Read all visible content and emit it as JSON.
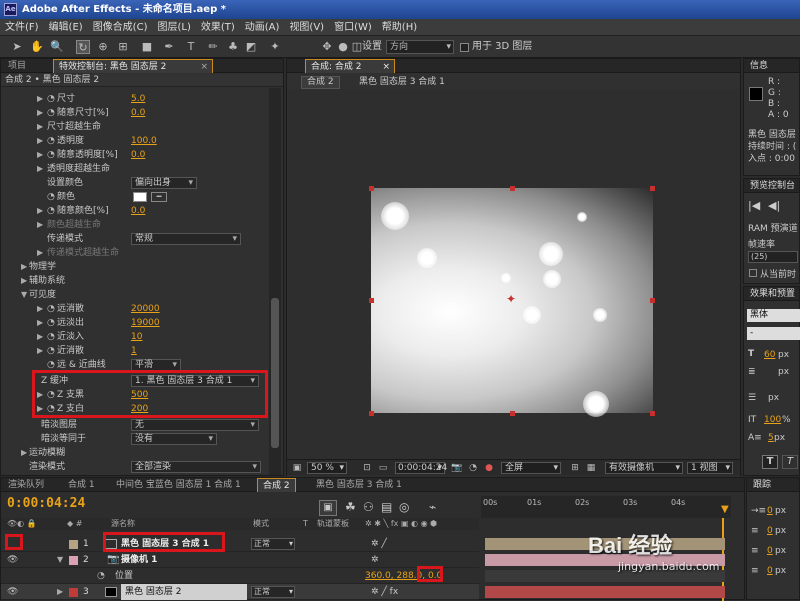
{
  "app": {
    "title": "Adobe After Effects - 未命名项目.aep *",
    "icon_text": "Ae"
  },
  "menu": [
    "文件(F)",
    "编辑(E)",
    "图像合成(C)",
    "图层(L)",
    "效果(T)",
    "动画(A)",
    "视图(V)",
    "窗口(W)",
    "帮助(H)"
  ],
  "toolbar": {
    "settings_label": "设置",
    "orientation_value": "方向",
    "use_for_3d_label": "用于 3D 图层"
  },
  "project_panel": {
    "tab_project": "项目",
    "tab_effect_controls": "特效控制台: 黑色 固态层 2",
    "header": "合成 2 • 黑色 固态层 2"
  },
  "effect_rows": [
    {
      "label": "尺寸",
      "value": "5.0"
    },
    {
      "label": "随意尺寸[%]",
      "value": "0.0"
    },
    {
      "label": "尺寸超越生命",
      "value": ""
    },
    {
      "label": "透明度",
      "value": "100.0"
    },
    {
      "label": "随意透明度[%]",
      "value": "0.0"
    },
    {
      "label": "透明度超越生命",
      "value": ""
    },
    {
      "label": "设置颜色",
      "value": "偏向出身"
    },
    {
      "label": "颜色",
      "value": ""
    },
    {
      "label": "随意颜色[%]",
      "value": "0.0"
    },
    {
      "label": "颜色超越生命",
      "value": ""
    },
    {
      "label": "传递模式",
      "value": "常规"
    },
    {
      "label": "传递模式超越生命",
      "value": ""
    },
    {
      "label": "物理学",
      "value": ""
    },
    {
      "label": "辅助系统",
      "value": ""
    },
    {
      "label": "可见度",
      "value": ""
    },
    {
      "label": "远消散",
      "value": "20000"
    },
    {
      "label": "远淡出",
      "value": "19000"
    },
    {
      "label": "近淡入",
      "value": "10"
    },
    {
      "label": "近消散",
      "value": "1"
    },
    {
      "label": "远 & 近曲线",
      "value": "平滑"
    },
    {
      "label": "Z 缓冲",
      "value": "1. 黑色 固态层 3 合成 1"
    },
    {
      "label": "Z 支黑",
      "value": "500"
    },
    {
      "label": "Z 支白",
      "value": "200"
    },
    {
      "label": "暗淡图层",
      "value": "无"
    },
    {
      "label": "暗淡等同于",
      "value": "没有"
    },
    {
      "label": "运动模糊",
      "value": ""
    },
    {
      "label": "渲染模式",
      "value": "全部渲染"
    }
  ],
  "composition": {
    "tab": "合成: 合成 2",
    "breadcrumb_active": "合成 2",
    "breadcrumb_path": "黑色 固态层 3 合成 1",
    "zoom": "50 %",
    "time": "0:00:04:24",
    "resolution": "全屏",
    "camera": "有效摄像机",
    "views": "1 视图"
  },
  "info_panel": {
    "tab": "信息",
    "r": "R :",
    "g": "G :",
    "b": "B :",
    "a": "A : 0",
    "layer_name": "黑色 固态层",
    "duration": "持续时间 : (",
    "in_point": "入点 : 0:00"
  },
  "preview_panel": {
    "tab": "预览控制台",
    "ram_preview": "RAM 预演道",
    "frame_rate_label": "帧速率",
    "frame_rate_value": "(25)",
    "from_current": "从当前时"
  },
  "effects_panel": {
    "tab": "效果和预置",
    "font": "黑体",
    "style": "-",
    "font_size": "60",
    "font_unit": "px",
    "leading": "px",
    "tracking": "px",
    "scale": "100",
    "scale_unit": "%",
    "baseline": "5",
    "baseline_unit": "px",
    "bold": "T",
    "italic": "T"
  },
  "timeline": {
    "tabs": [
      "渲染队列",
      "合成 1",
      "中间色 宝蓝色 固态层 1 合成 1",
      "合成 2",
      "黑色 固态层 3 合成 1"
    ],
    "active_tab_index": 3,
    "current_time": "0:00:04:24",
    "col_source": "源名称",
    "col_mode": "模式",
    "col_t": "T",
    "col_track": "轨道蒙板",
    "layers": [
      {
        "num": "1",
        "name": "黑色 固态层 3 合成 1",
        "mode": "正常",
        "color": "#b8a284"
      },
      {
        "num": "2",
        "name": "摄像机 1",
        "mode": "",
        "color": "#d9a1b1"
      },
      {
        "num": "3",
        "name": "黑色 固态层 2",
        "mode": "正常",
        "color": "#c23b3b"
      }
    ],
    "position_label": "位置",
    "position_value": "360.0, 288.0, 0.0",
    "ruler": [
      "00s",
      "01s",
      "02s",
      "03s",
      "04s"
    ]
  },
  "right_tabs": {
    "tracker": "跟踪",
    "spacing": [
      {
        "value": "0",
        "unit": "px"
      },
      {
        "value": "0",
        "unit": "px"
      },
      {
        "value": "0",
        "unit": "px"
      },
      {
        "value": "0",
        "unit": "px"
      }
    ]
  },
  "watermark": {
    "brand": "Bai 经验",
    "url": "jingyan.baidu.com"
  }
}
